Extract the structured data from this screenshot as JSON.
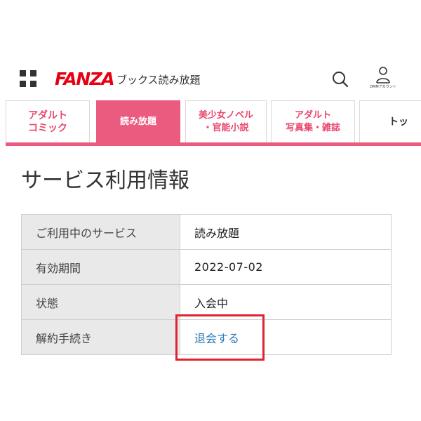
{
  "header": {
    "logo_text": "FANZA",
    "service_name": "ブックス読み放題",
    "account_label": "DMMアカウント",
    "icons": {
      "menu": "grid-menu-icon",
      "search": "search-icon",
      "account": "user-icon"
    }
  },
  "tabs": [
    {
      "label": "アダルト\nコミック",
      "active": false
    },
    {
      "label": "読み放題",
      "active": true
    },
    {
      "label": "美少女ノベル\n・官能小説",
      "active": false
    },
    {
      "label": "アダルト\n写真集・雑誌",
      "active": false
    },
    {
      "label": "トッ",
      "active": false
    }
  ],
  "page_title": "サービス利用情報",
  "info_table": {
    "rows": [
      {
        "label": "ご利用中のサービス",
        "value": "読み放題"
      },
      {
        "label": "有効期間",
        "value": "2022-07-02"
      },
      {
        "label": "状態",
        "value": "入会中"
      },
      {
        "label": "解約手続き",
        "value": "退会する"
      }
    ]
  },
  "colors": {
    "brand_red": "#e60012",
    "tab_pink": "#eb5a7f",
    "link_blue": "#2a7ab5",
    "highlight_red": "#e0232e"
  }
}
